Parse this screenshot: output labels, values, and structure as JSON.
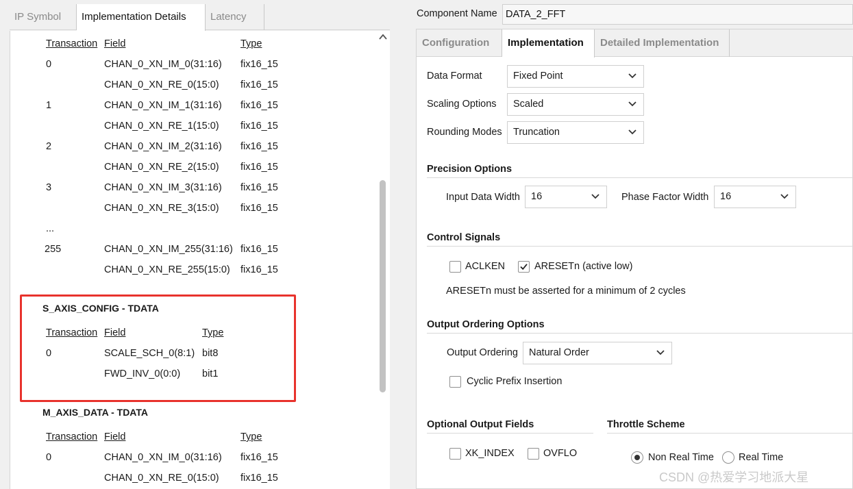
{
  "left": {
    "tabs": [
      "IP Symbol",
      "Implementation Details",
      "Latency"
    ],
    "top_table": {
      "headers": [
        "Transaction",
        "Field",
        "Type"
      ],
      "rows": [
        [
          "0",
          "CHAN_0_XN_IM_0(31:16)",
          "fix16_15"
        ],
        [
          "",
          "CHAN_0_XN_RE_0(15:0)",
          "fix16_15"
        ],
        [
          "1",
          "CHAN_0_XN_IM_1(31:16)",
          "fix16_15"
        ],
        [
          "",
          "CHAN_0_XN_RE_1(15:0)",
          "fix16_15"
        ],
        [
          "2",
          "CHAN_0_XN_IM_2(31:16)",
          "fix16_15"
        ],
        [
          "",
          "CHAN_0_XN_RE_2(15:0)",
          "fix16_15"
        ],
        [
          "3",
          "CHAN_0_XN_IM_3(31:16)",
          "fix16_15"
        ],
        [
          "",
          "CHAN_0_XN_RE_3(15:0)",
          "fix16_15"
        ],
        [
          "...",
          "",
          ""
        ],
        [
          "255",
          "CHAN_0_XN_IM_255(31:16)",
          "fix16_15"
        ],
        [
          "",
          "CHAN_0_XN_RE_255(15:0)",
          "fix16_15"
        ]
      ]
    },
    "config_section": {
      "title": "S_AXIS_CONFIG - TDATA",
      "headers": [
        "Transaction",
        "Field",
        "Type"
      ],
      "rows": [
        [
          "0",
          "SCALE_SCH_0(8:1)",
          "bit8"
        ],
        [
          "",
          "FWD_INV_0(0:0)",
          "bit1"
        ]
      ]
    },
    "data_section": {
      "title": "M_AXIS_DATA - TDATA",
      "headers": [
        "Transaction",
        "Field",
        "Type"
      ],
      "rows": [
        [
          "0",
          "CHAN_0_XN_IM_0(31:16)",
          "fix16_15"
        ],
        [
          "",
          "CHAN_0_XN_RE_0(15:0)",
          "fix16_15"
        ]
      ]
    }
  },
  "right": {
    "component_name_label": "Component Name",
    "component_name_value": "DATA_2_FFT",
    "tabs": [
      "Configuration",
      "Implementation",
      "Detailed Implementation"
    ],
    "data_format": {
      "label": "Data Format",
      "value": "Fixed Point"
    },
    "scaling_options": {
      "label": "Scaling Options",
      "value": "Scaled"
    },
    "rounding_modes": {
      "label": "Rounding Modes",
      "value": "Truncation"
    },
    "precision": {
      "title": "Precision Options",
      "input_width_label": "Input Data Width",
      "input_width_value": "16",
      "phase_width_label": "Phase Factor Width",
      "phase_width_value": "16"
    },
    "control": {
      "title": "Control Signals",
      "aclken_label": "ACLKEN",
      "aclken_checked": false,
      "aresetn_label": "ARESETn (active low)",
      "aresetn_checked": true,
      "note": "ARESETn must be asserted for a minimum of 2 cycles"
    },
    "ordering": {
      "title": "Output Ordering Options",
      "label": "Output Ordering",
      "value": "Natural Order",
      "cyclic_label": "Cyclic Prefix Insertion",
      "cyclic_checked": false
    },
    "optional": {
      "title": "Optional Output Fields",
      "xk_index_label": "XK_INDEX",
      "ovflo_label": "OVFLO"
    },
    "throttle": {
      "title": "Throttle Scheme",
      "non_real_time_label": "Non Real Time",
      "real_time_label": "Real Time",
      "selected": "Non Real Time"
    }
  },
  "watermark": "CSDN @热爱学习地派大星",
  "colors": {
    "highlight": "#e8322c",
    "panel_bg": "#f0f0f0"
  }
}
